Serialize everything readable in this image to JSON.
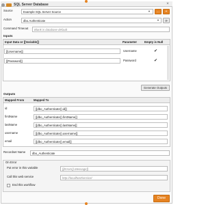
{
  "window": {
    "title": "SQL Server Database",
    "close_glyph": "×"
  },
  "form": {
    "source_label": "Source",
    "source_value": "Example SQL Server Source",
    "source_more": "...",
    "action_label": "Action",
    "action_value": "dbo.Authenticate",
    "command_timeout_label": "Command Timeout",
    "command_timeout_placeholder": "Blank is database default"
  },
  "inputs": {
    "title": "Inputs",
    "columns": [
      "Input Data or [[Variable]]",
      "Parameter",
      "Empty is Null"
    ],
    "rows": [
      {
        "value": "[[Username]]",
        "parameter": "Username",
        "empty_is_null": true
      },
      {
        "value": "[[Password]]",
        "parameter": "Password",
        "empty_is_null": true
      }
    ],
    "generate_button": "Generate Outputs"
  },
  "outputs": {
    "title": "Outputs",
    "columns": [
      "Mapped From",
      "Mapped To"
    ],
    "rows": [
      {
        "from": "id",
        "to": "[[dbo_Authenticate().id]]"
      },
      {
        "from": "firstName",
        "to": "[[dbo_Authenticate().firstName]]"
      },
      {
        "from": "lastName",
        "to": "[[dbo_Authenticate().lastName]]"
      },
      {
        "from": "username",
        "to": "[[dbo_Authenticate().username]]"
      },
      {
        "from": "email",
        "to": "[[dbo_Authenticate().email]]"
      }
    ]
  },
  "recordset": {
    "label": "Recordset Name",
    "value": "dbo_Authenticate"
  },
  "on_error": {
    "title": "On Error",
    "put_error_label": "Put error in this variable",
    "put_error_placeholder": "[[Errors().Message]]",
    "call_service_label": "Call this web service",
    "call_service_placeholder": "http://localhost/service/",
    "end_workflow_label": "End this workflow"
  },
  "footer": {
    "done_label": "Done"
  },
  "colors": {
    "accent": "#e68321",
    "header_bg": "#efefef",
    "grid_header_bg": "#ececec"
  },
  "icons": [
    "gear-icon",
    "database-icon",
    "close-icon",
    "refresh-icon",
    "checkmark-icon"
  ]
}
